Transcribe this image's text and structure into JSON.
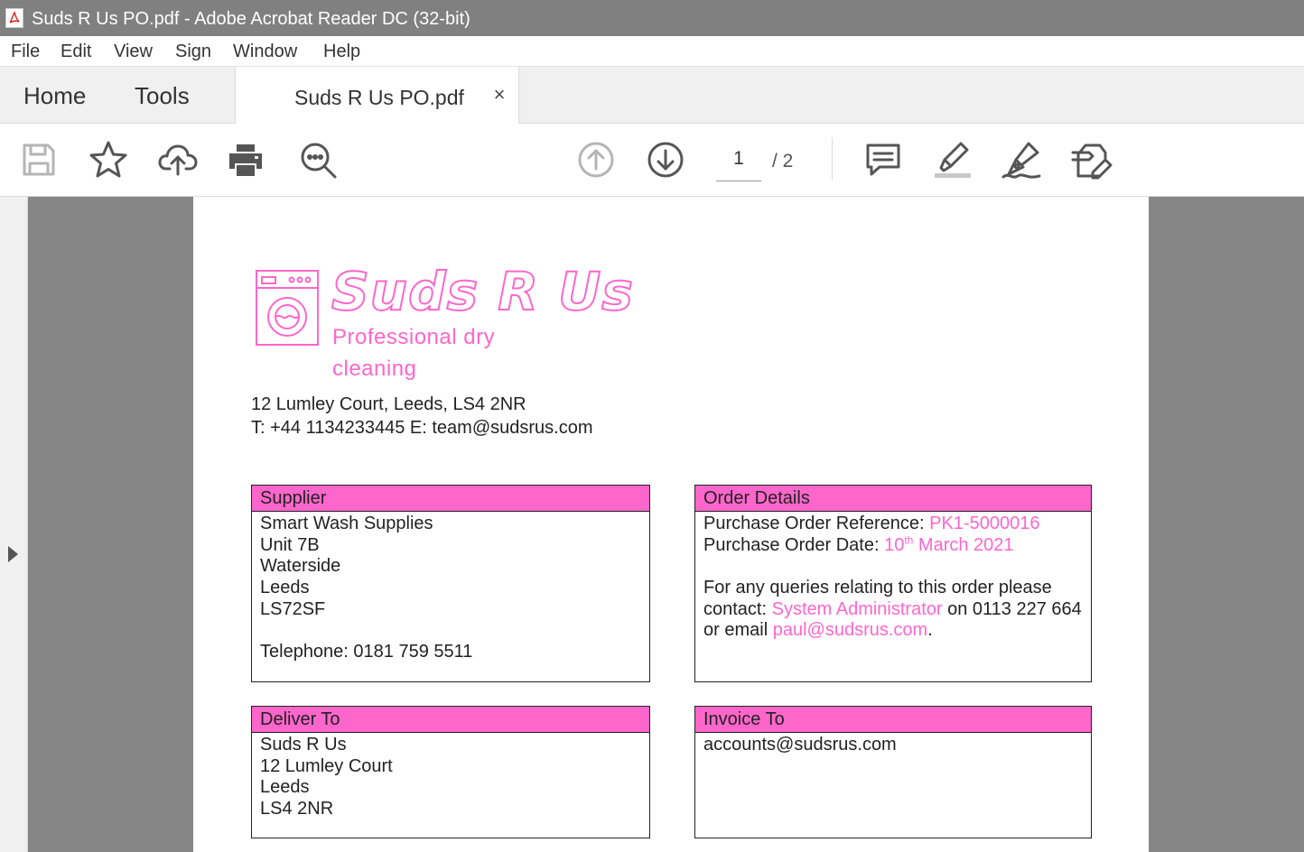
{
  "window": {
    "title": "Suds R Us PO.pdf - Adobe Acrobat Reader DC (32-bit)",
    "app_icon": "acrobat-pdf-icon"
  },
  "menu": {
    "items": [
      "File",
      "Edit",
      "View",
      "Sign",
      "Window",
      "Help"
    ]
  },
  "tabs": {
    "home": "Home",
    "tools": "Tools",
    "document": "Suds R Us PO.pdf",
    "close": "×"
  },
  "toolbar": {
    "icons": [
      "save-icon",
      "star-icon",
      "cloud-upload-icon",
      "print-icon",
      "zoom-search-icon",
      "page-up-icon",
      "page-down-icon",
      "comment-icon",
      "highlight-icon",
      "sign-pen-icon",
      "fill-sign-icon"
    ],
    "page_current": "1",
    "page_total": "/ 2"
  },
  "document": {
    "brand": {
      "name": "Suds R Us",
      "tagline": "Professional dry cleaning",
      "logo": "washing-machine-icon",
      "color": "#ff66cc"
    },
    "address_line": "12 Lumley Court, Leeds, LS4 2NR",
    "contact_line": "T: +44 1134233445 E: team@sudsrus.com",
    "supplier": {
      "heading": "Supplier",
      "name": "Smart Wash Supplies",
      "line1": "Unit 7B",
      "line2": "Waterside",
      "line3": "Leeds",
      "line4": "LS72SF",
      "telephone": "Telephone: 0181 759 5511"
    },
    "order_details": {
      "heading": "Order Details",
      "ref_label": "Purchase Order Reference: ",
      "ref_value": "PK1-5000016",
      "date_label": "Purchase Order Date: ",
      "date_day": "10",
      "date_suffix": "th",
      "date_rest": " March 2021",
      "query_line1": "For any queries relating to this order please",
      "query_contact_label": "contact: ",
      "contact_name": "System Administrator",
      "contact_phone_text": " on 0113 227 664",
      "email_label": "or email ",
      "email_value": "paul@sudsrus.com",
      "email_end": "."
    },
    "deliver_to": {
      "heading": "Deliver To",
      "line1": "Suds R Us",
      "line2": "12 Lumley Court",
      "line3": "Leeds",
      "line4": "LS4 2NR"
    },
    "invoice_to": {
      "heading": "Invoice To",
      "email": "accounts@sudsrus.com"
    }
  }
}
